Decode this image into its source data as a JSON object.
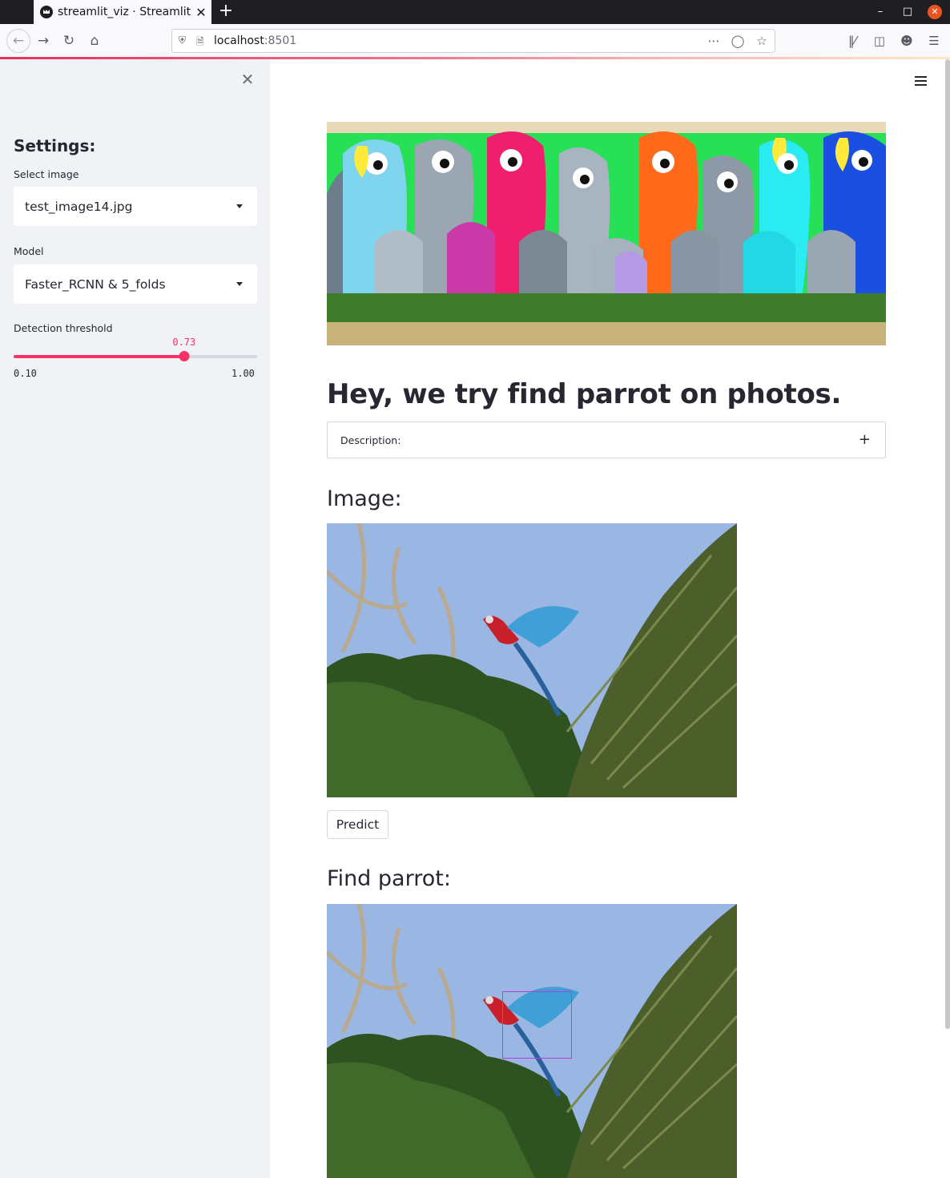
{
  "browser": {
    "tab_title": "streamlit_viz · Streamlit",
    "tab_close": "✕",
    "new_tab": "+",
    "url_host": "localhost",
    "url_port": ":8501",
    "icons": [
      "back-icon",
      "forward-icon",
      "reload-icon",
      "home-icon",
      "shield-icon",
      "page-icon",
      "more-icon",
      "pocket-icon",
      "star-icon",
      "library-icon",
      "sidebar-icon",
      "account-icon",
      "menu-icon"
    ]
  },
  "sidebar": {
    "close": "✕",
    "heading": "Settings:",
    "select_image_label": "Select image",
    "select_image_value": "test_image14.jpg",
    "model_label": "Model",
    "model_value": "Faster_RCNN & 5_folds",
    "threshold_label": "Detection threshold",
    "threshold_value": "0.73",
    "threshold_min": "0.10",
    "threshold_max": "1.00",
    "threshold_fraction": 0.7
  },
  "main": {
    "title": "Hey, we try find parrot on photos.",
    "expander_label": "Description:",
    "expander_icon": "+",
    "image_heading": "Image:",
    "predict_label": "Predict",
    "result_heading": "Find parrot:"
  },
  "colors": {
    "accent": "#f63366",
    "sidebar_bg": "#f0f2f6",
    "bbox": "#c03ad8"
  }
}
